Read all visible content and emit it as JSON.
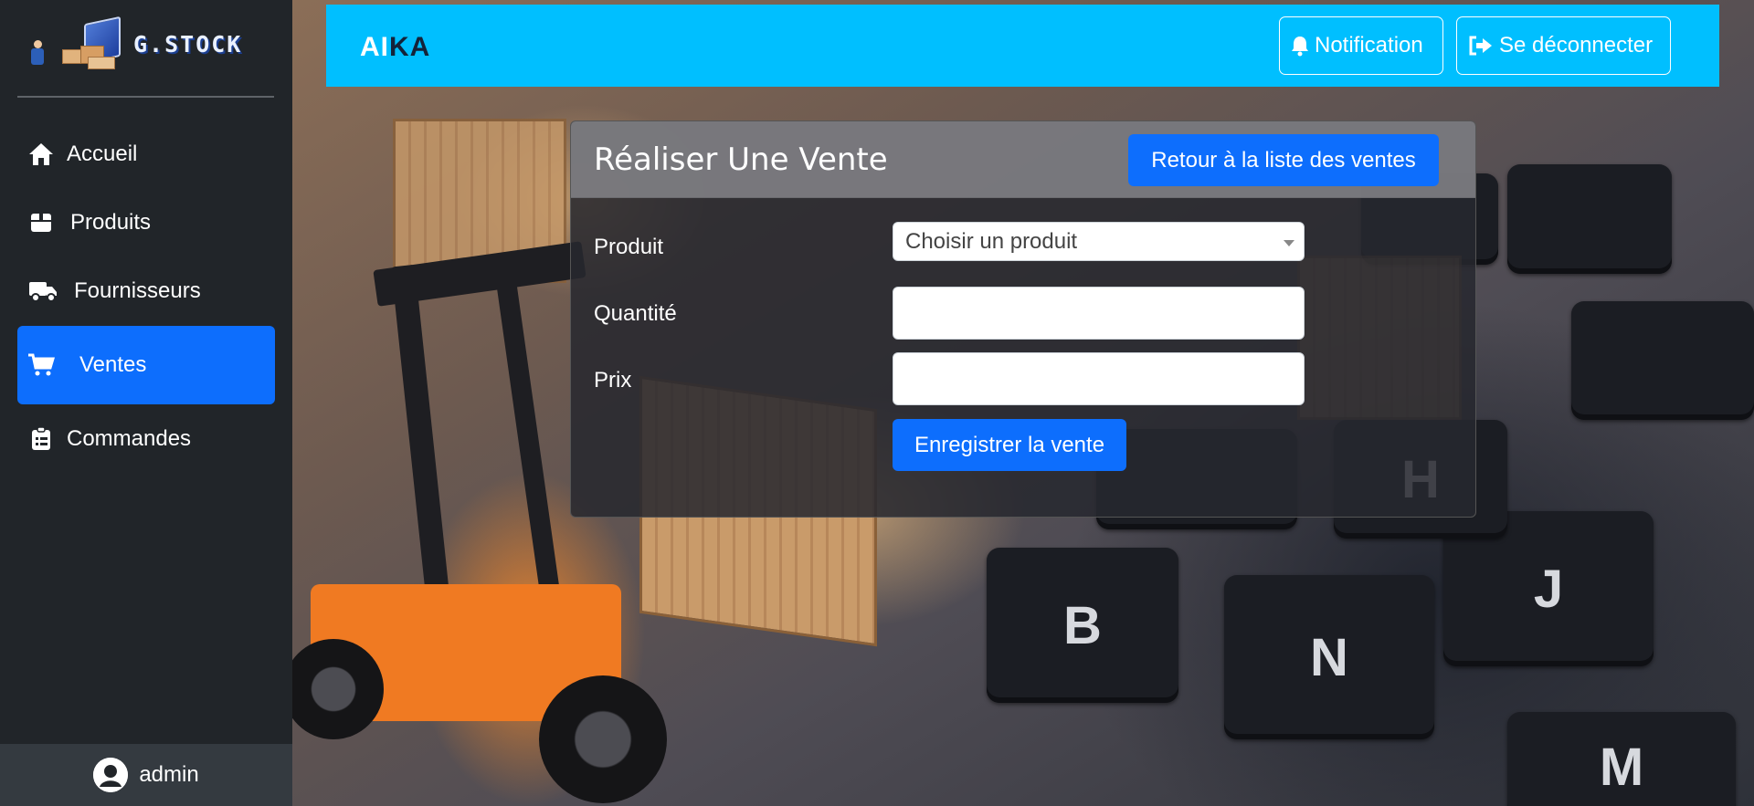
{
  "app": {
    "logo_text": "G.STOCK",
    "brand_part1": "AI",
    "brand_part2": "KA",
    "accent_color": "#0d6efd",
    "header_color": "#00bfff",
    "sidebar_color": "#212529"
  },
  "header": {
    "notification_label": "Notification",
    "logout_label": "Se déconnecter"
  },
  "sidebar": {
    "items": [
      {
        "label": "Accueil",
        "icon": "home-icon",
        "active": false
      },
      {
        "label": "Produits",
        "icon": "box-icon",
        "active": false
      },
      {
        "label": "Fournisseurs",
        "icon": "truck-icon",
        "active": false
      },
      {
        "label": "Ventes",
        "icon": "cart-icon",
        "active": true
      },
      {
        "label": "Commandes",
        "icon": "clipboard-icon",
        "active": false
      }
    ],
    "user": "admin"
  },
  "card": {
    "title": "Réaliser Une Vente",
    "back_button": "Retour à la liste des ventes",
    "fields": {
      "product_label": "Produit",
      "product_placeholder": "Choisir un produit",
      "quantity_label": "Quantité",
      "quantity_value": "",
      "price_label": "Prix",
      "price_value": ""
    },
    "submit_button": "Enregistrer la vente"
  }
}
